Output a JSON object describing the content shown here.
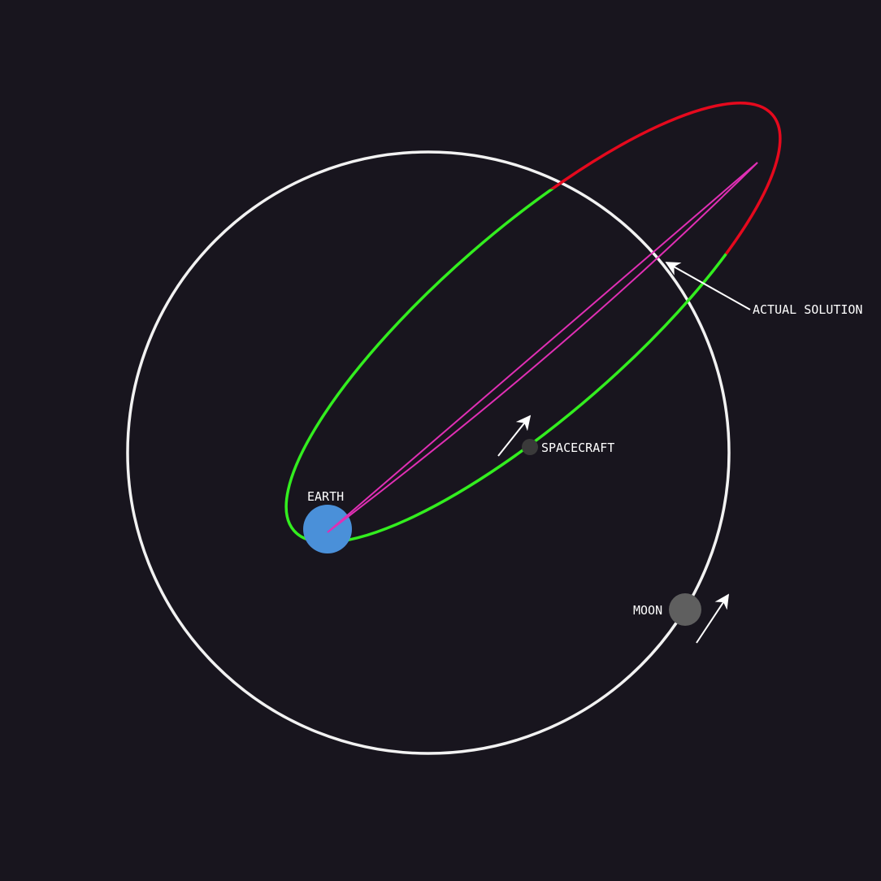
{
  "colors": {
    "background": "#18151e",
    "moon_orbit": "#f2f2f2",
    "transfer_orbit_inside": "#33ee1f",
    "transfer_orbit_outside": "#e5091d",
    "actual_solution": "#e02fb4",
    "earth": "#4a90d9",
    "moon": "#5f5f5f",
    "spacecraft": "#3a3a3a",
    "arrow": "#ffffff"
  },
  "labels": {
    "earth": "EARTH",
    "moon": "MOON",
    "spacecraft": "SPACECRAFT",
    "actual_solution": "ACTUAL SOLUTION"
  },
  "icons": {
    "earth": "earth-icon",
    "moon": "moon-icon",
    "spacecraft": "spacecraft-icon",
    "velocity_arrow": "arrow-icon"
  }
}
